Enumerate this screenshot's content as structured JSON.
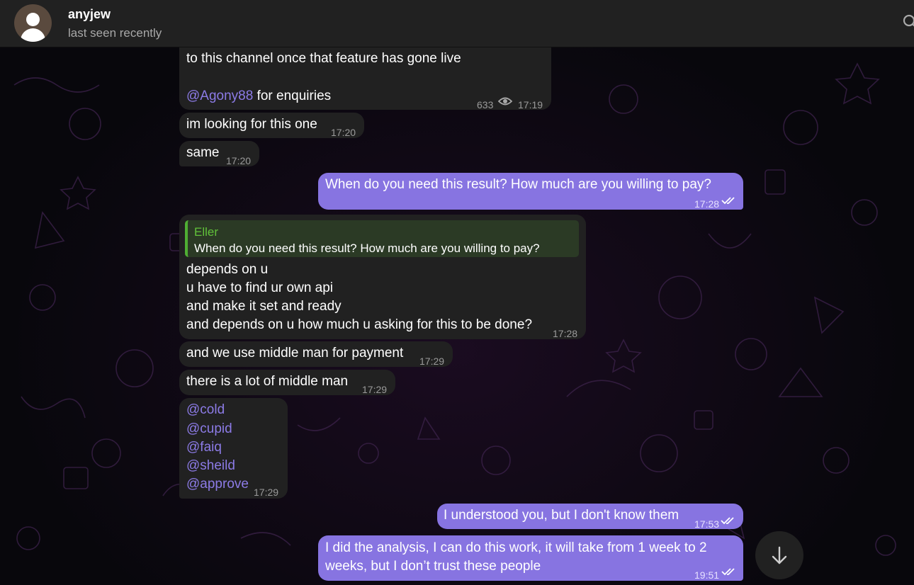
{
  "header": {
    "contact_name": "anyjew",
    "contact_status": "last seen recently"
  },
  "messages": [
    {
      "direction": "in",
      "lines": [
        "to this channel once that feature has gone live"
      ],
      "mention": "@Agony88",
      "mention_suffix": " for enquiries",
      "views": "633",
      "time": "17:19"
    },
    {
      "direction": "in",
      "text": "im looking for this one",
      "time": "17:20"
    },
    {
      "direction": "in",
      "text": "same",
      "time": "17:20"
    },
    {
      "direction": "out",
      "text": "When do you need this result? How much are you willing to pay?",
      "time": "17:28",
      "read": true
    },
    {
      "direction": "in",
      "reply": {
        "author": "Eller",
        "text": "When do you need this result? How much are you willing to pay?"
      },
      "lines": [
        "depends on u",
        "u have to find ur own api",
        "and make it set and ready",
        "and depends on u how much u asking for this to be done?"
      ],
      "time": "17:28"
    },
    {
      "direction": "in",
      "text": "and we use middle man for payment",
      "time": "17:29"
    },
    {
      "direction": "in",
      "text": "there is a lot of middle man",
      "time": "17:29"
    },
    {
      "direction": "in",
      "mentions": [
        "@cold",
        "@cupid",
        "@faiq",
        "@sheild",
        "@approve"
      ],
      "time": "17:29"
    },
    {
      "direction": "out",
      "text": "I understood you, but I don't know them",
      "time": "17:53",
      "read": true
    },
    {
      "direction": "out",
      "lines": [
        "I did the analysis, I can do this work, it will take from 1 week to 2",
        "weeks, but I don’t trust these people"
      ],
      "time": "19:51",
      "read": true
    }
  ],
  "icons": {
    "search": "search-icon",
    "views": "eye-icon",
    "read": "double-check-icon",
    "scroll": "arrow-down-icon",
    "avatar": "user-avatar-icon"
  },
  "colors": {
    "header_bg": "#212121",
    "incoming_bubble": "#212121",
    "outgoing_bubble": "#8774e1",
    "mention": "#8c7be6",
    "reply_accent": "#4fae33"
  }
}
